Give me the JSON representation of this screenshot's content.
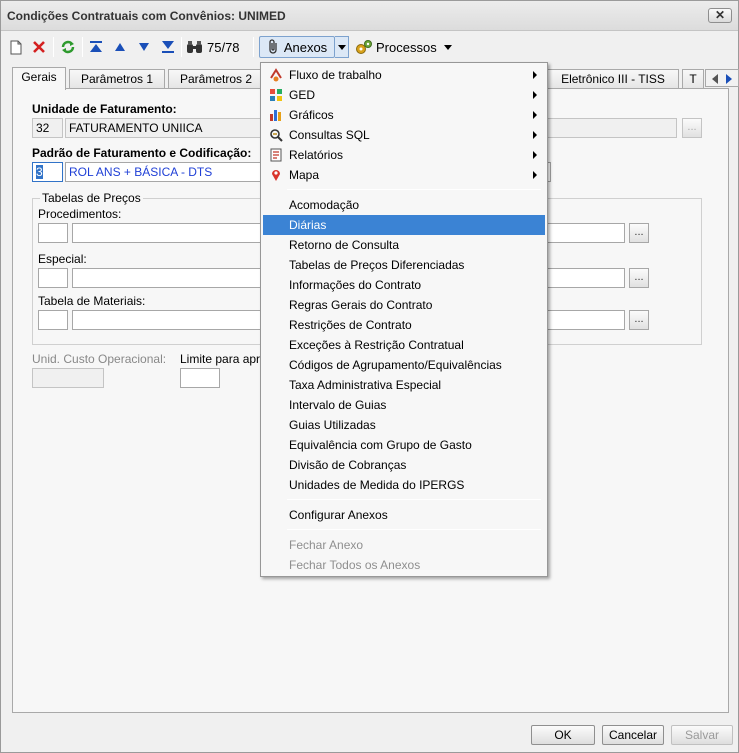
{
  "window": {
    "title": "Condições Contratuais com Convênios: UNIMED",
    "close_label": "✕"
  },
  "toolbar": {
    "record_counter": "75/78",
    "anexos_label": "Anexos",
    "processos_label": "Processos"
  },
  "tabs": [
    {
      "label": "Gerais",
      "active": true
    },
    {
      "label": "Parâmetros 1"
    },
    {
      "label": "Parâmetros 2"
    },
    {
      "label": "Eletrônico III - TISS"
    },
    {
      "label": "T"
    }
  ],
  "form": {
    "unidade_label": "Unidade de Faturamento:",
    "unidade_code": "32",
    "unidade_name": "FATURAMENTO UNIICA",
    "padrao_label": "Padrão de Faturamento e Codificação:",
    "padrao_code": "3",
    "padrao_name": "ROL ANS + BÁSICA - DTS",
    "tabelas_title": "Tabelas de Preços",
    "procedimentos_label": "Procedimentos:",
    "especial_label": "Especial:",
    "materiais_label": "Tabela de Materiais:",
    "custo_label": "Unid. Custo Operacional:",
    "limite_label": "Limite para apre",
    "dots": "..."
  },
  "menu": {
    "submenus": [
      {
        "label": "Fluxo de trabalho",
        "icon": "workflow-icon"
      },
      {
        "label": "GED",
        "icon": "ged-icon"
      },
      {
        "label": "Gráficos",
        "icon": "bar-chart-icon"
      },
      {
        "label": "Consultas SQL",
        "icon": "sql-query-icon"
      },
      {
        "label": "Relatórios",
        "icon": "report-icon"
      },
      {
        "label": "Mapa",
        "icon": "map-pin-icon"
      }
    ],
    "items": [
      "Acomodação",
      "Diárias",
      "Retorno de Consulta",
      "Tabelas de Preços Diferenciadas",
      "Informações do Contrato",
      "Regras Gerais do Contrato",
      "Restrições de Contrato",
      "Exceções à Restrição Contratual",
      "Códigos de Agrupamento/Equivalências",
      "Taxa Administrativa Especial",
      "Intervalo de Guias",
      "Guias Utilizadas",
      "Equivalência com Grupo de Gasto",
      "Divisão de Cobranças",
      "Unidades de Medida do IPERGS"
    ],
    "highlighted": "Diárias",
    "configurar": "Configurar Anexos",
    "fechar": "Fechar Anexo",
    "fechar_todos": "Fechar Todos os Anexos"
  },
  "footer": {
    "ok": "OK",
    "cancel": "Cancelar",
    "save": "Salvar"
  },
  "colors": {
    "highlight": "#3b83d4",
    "link_blue": "#1f3fd6"
  }
}
